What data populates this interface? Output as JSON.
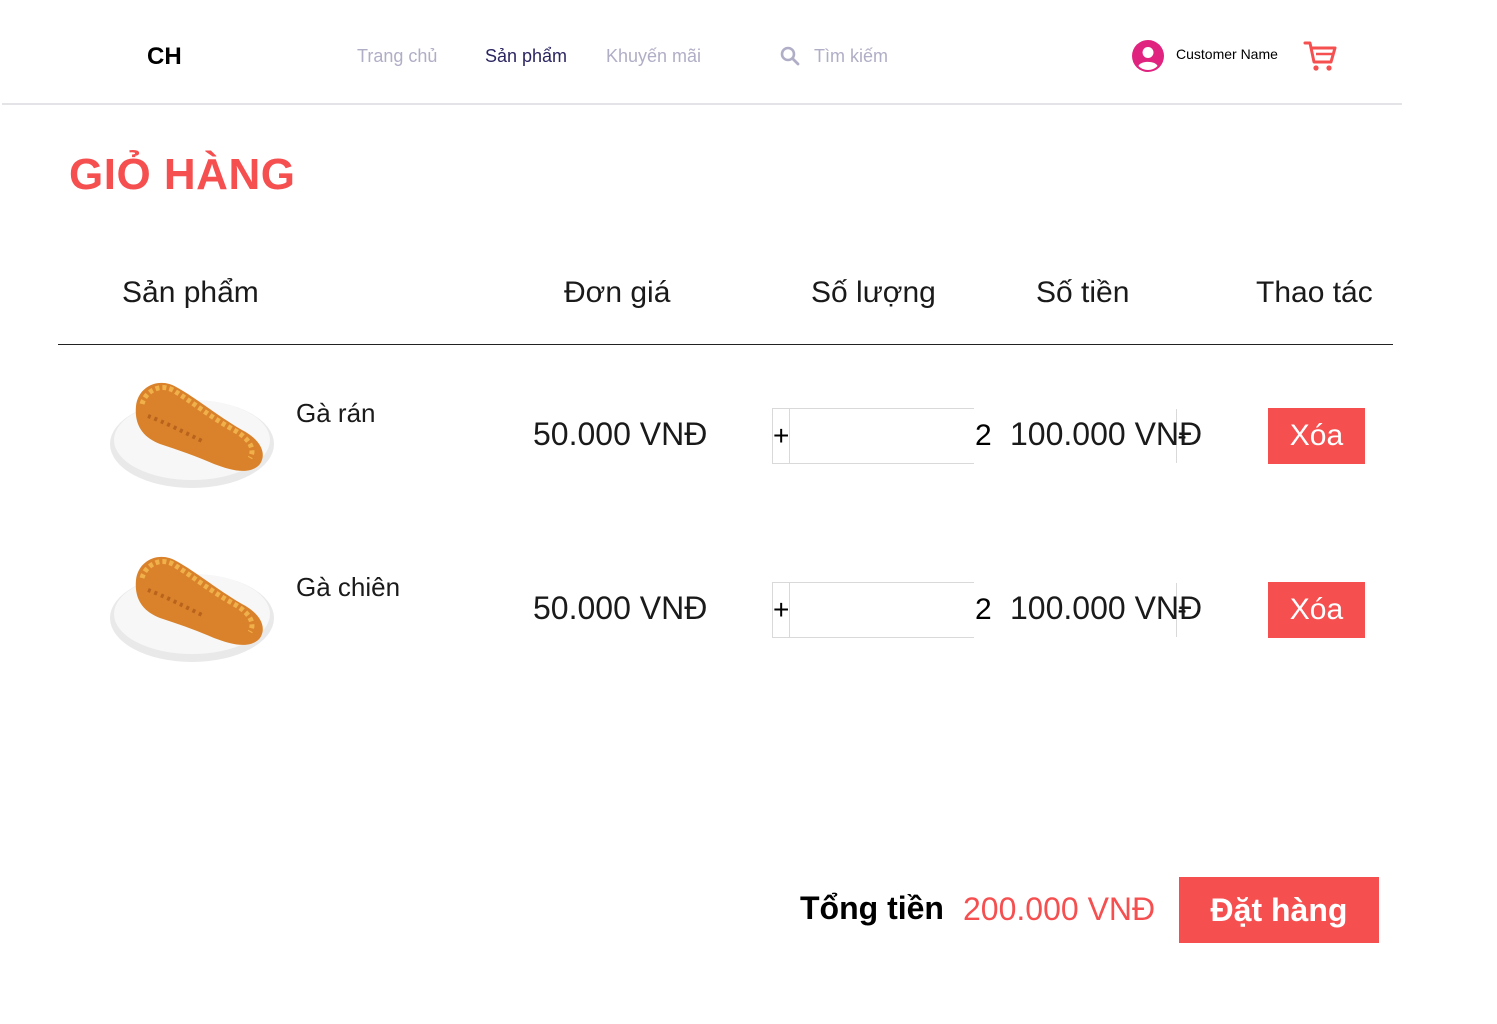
{
  "header": {
    "logo": "CH",
    "nav": [
      {
        "label": "Trang chủ",
        "active": false
      },
      {
        "label": "Sản phẩm",
        "active": true
      },
      {
        "label": "Khuyến mãi",
        "active": false
      }
    ],
    "search": {
      "placeholder": "Tìm kiếm",
      "value": ""
    },
    "user": {
      "name": "Customer Name",
      "avatar_icon": "user-circle-icon",
      "avatar_color": "#e0237f"
    },
    "cart_icon": "shopping-cart-icon",
    "cart_color": "#f54f50"
  },
  "page": {
    "title": "GIỎ HÀNG"
  },
  "table": {
    "columns": [
      "Sản phẩm",
      "Đơn giá",
      "Số lượng",
      "Số tiền",
      "Thao tác"
    ],
    "rows": [
      {
        "name": "Gà rán",
        "unit_price": "50.000 VNĐ",
        "plus": "+",
        "quantity": "2",
        "minus": "-",
        "total": "100.000 VNĐ",
        "action": "Xóa"
      },
      {
        "name": "Gà chiên",
        "unit_price": "50.000 VNĐ",
        "plus": "+",
        "quantity": "2",
        "minus": "-",
        "total": "100.000 VNĐ",
        "action": "Xóa"
      }
    ]
  },
  "footer": {
    "total_label": "Tổng tiền",
    "total_value": "200.000 VNĐ",
    "order_button": "Đặt hàng"
  },
  "colors": {
    "accent": "#f54f50",
    "nav_active": "#2a2560",
    "nav_inactive": "#b0aec6"
  }
}
